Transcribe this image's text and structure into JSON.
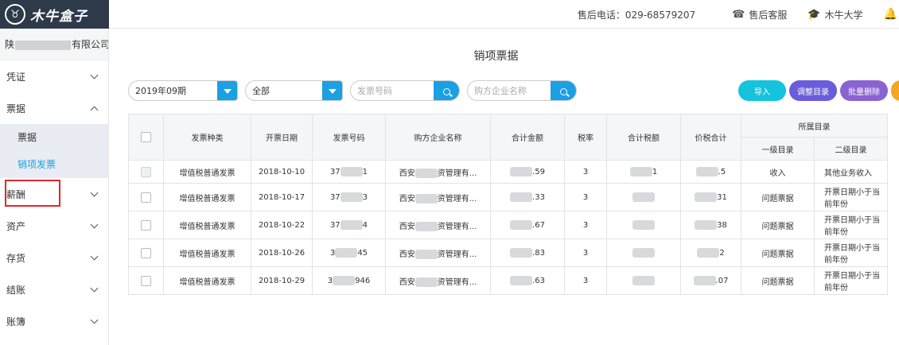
{
  "topbar": {
    "brand": "木牛盒子",
    "phone": "售后电话：029-68579207",
    "service": "售后客服",
    "university": "木牛大学"
  },
  "sidebar": {
    "company_prefix": "陕",
    "company_suffix": "有限公司",
    "items": [
      {
        "label": "凭证"
      },
      {
        "label": "票据"
      },
      {
        "label": "薪酬"
      },
      {
        "label": "资产"
      },
      {
        "label": "存货"
      },
      {
        "label": "结账"
      },
      {
        "label": "账簿"
      }
    ],
    "sub_items": [
      {
        "label": "票据"
      },
      {
        "label": "销项发票"
      }
    ]
  },
  "page": {
    "title": "销项票据"
  },
  "filters": {
    "period": "2019年09期",
    "type": "全部",
    "invoice_no_placeholder": "发票号码",
    "buyer_placeholder": "购方企业名称"
  },
  "actions": {
    "import": "导入",
    "adjust": "调整目录",
    "batch_delete": "批量删除"
  },
  "colors": {
    "accent": "#1aa0e3",
    "teal": "#14c3dc",
    "purple": "#6a5ddb",
    "violet": "#8a63d2",
    "orange": "#f5a623"
  },
  "table": {
    "headers": {
      "type": "发票种类",
      "date": "开票日期",
      "number": "发票号码",
      "buyer": "购方企业名称",
      "amount": "合计金额",
      "rate": "税率",
      "tax": "合计税额",
      "total": "价税合计",
      "category": "所属目录",
      "level1": "一级目录",
      "level2": "二级目录"
    },
    "rows": [
      {
        "type": "增值税普通发票",
        "date": "2018-10-10",
        "num_a": "37",
        "num_b": "1",
        "buyer_a": "西安",
        "buyer_b": "资管理有...",
        "amount": ".59",
        "rate": "3",
        "tax": "1",
        "total": ".5",
        "level1": "收入",
        "level2": "其他业务收入"
      },
      {
        "type": "增值税普通发票",
        "date": "2018-10-17",
        "num_a": "37",
        "num_b": "3",
        "buyer_a": "西安",
        "buyer_b": "资管理有...",
        "amount": ".33",
        "rate": "3",
        "tax": "",
        "total": "31",
        "level1": "问题票据",
        "level2": "开票日期小于当前年份"
      },
      {
        "type": "增值税普通发票",
        "date": "2018-10-22",
        "num_a": "37",
        "num_b": "4",
        "buyer_a": "西安",
        "buyer_b": "资管理有...",
        "amount": ".67",
        "rate": "3",
        "tax": "",
        "total": "38",
        "level1": "问题票据",
        "level2": "开票日期小于当前年份"
      },
      {
        "type": "增值税普通发票",
        "date": "2018-10-26",
        "num_a": "3",
        "num_b": "45",
        "buyer_a": "西安",
        "buyer_b": "资管理有...",
        "amount": ".83",
        "rate": "3",
        "tax": "",
        "total": "2",
        "level1": "问题票据",
        "level2": "开票日期小于当前年份"
      },
      {
        "type": "增值税普通发票",
        "date": "2018-10-29",
        "num_a": "3",
        "num_b": "946",
        "buyer_a": "西安",
        "buyer_b": "资管理有...",
        "amount": ".63",
        "rate": "3",
        "tax": "",
        "total": ".07",
        "level1": "问题票据",
        "level2": "开票日期小于当前年份"
      }
    ]
  }
}
